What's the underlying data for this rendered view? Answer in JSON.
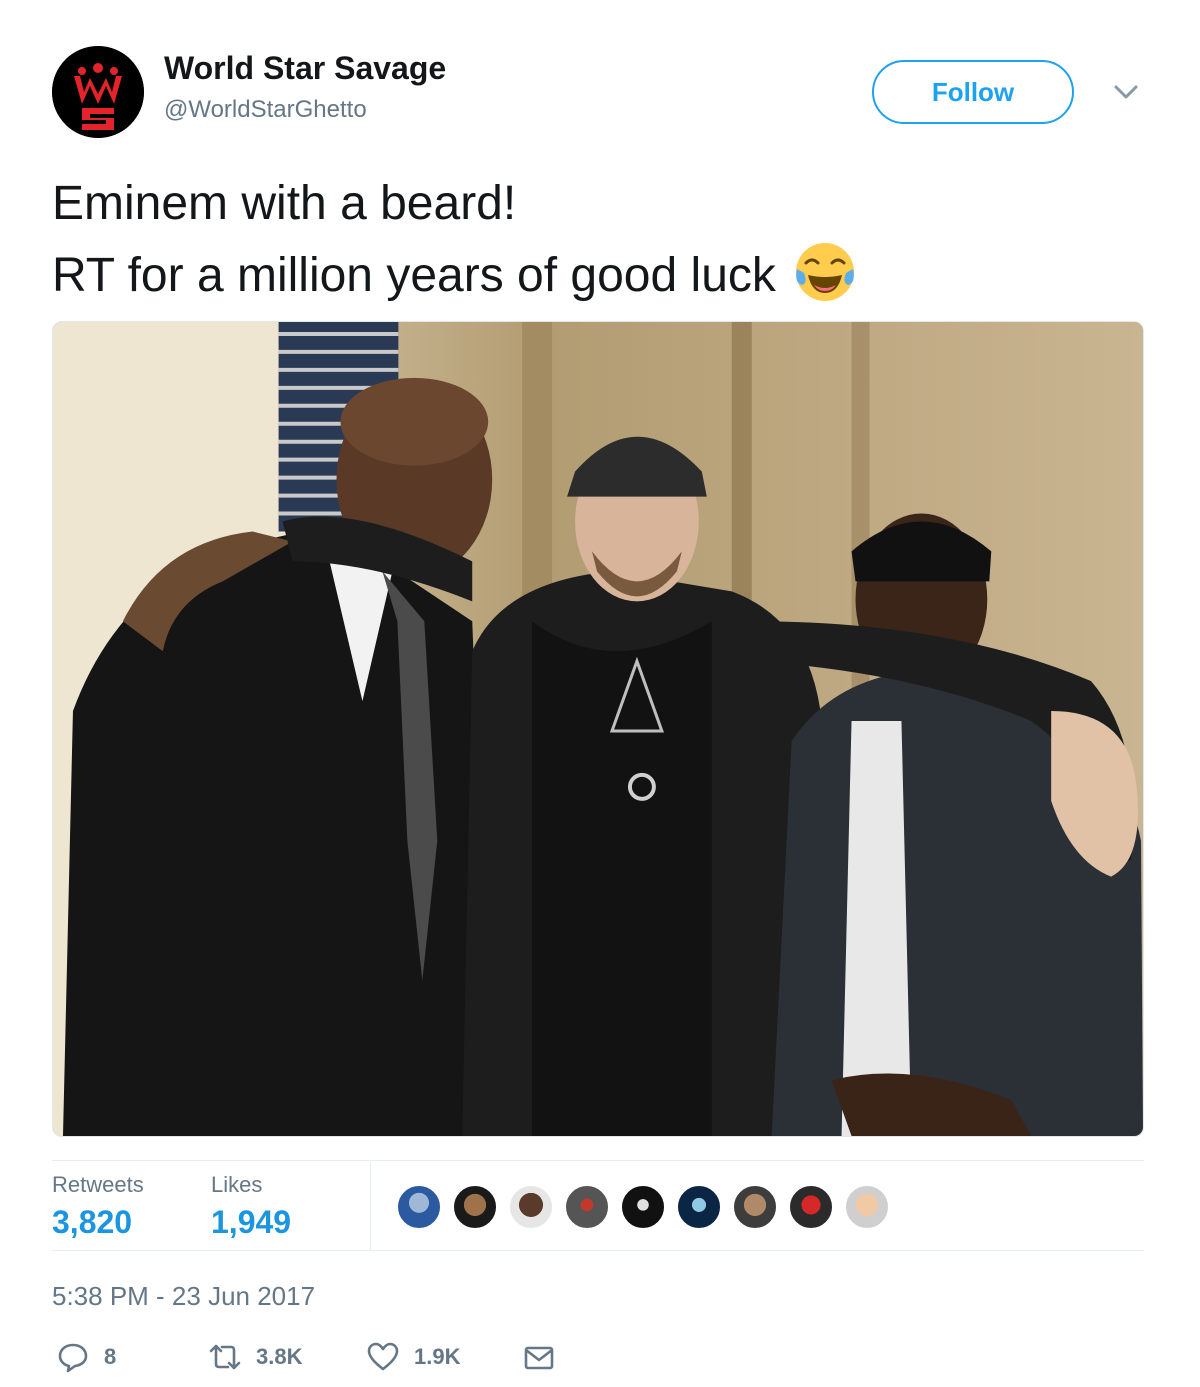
{
  "header": {
    "display_name": "World Star Savage",
    "handle": "@WorldStarGhetto",
    "follow_label": "Follow",
    "avatar_logo_text": "WS"
  },
  "tweet": {
    "line1": "Eminem with a beard!",
    "line2": "RT for a million years of good luck",
    "emoji": "face-with-tears-of-joy-emoji"
  },
  "stats": {
    "retweets_label": "Retweets",
    "retweets_value": "3,820",
    "likes_label": "Likes",
    "likes_value": "1,949"
  },
  "timestamp": "5:38 PM - 23 Jun 2017",
  "actions": {
    "reply_count": "8",
    "retweet_count": "3.8K",
    "like_count": "1.9K"
  },
  "colors": {
    "accent": "#1da1f2",
    "stat_value": "#1b95e0",
    "muted": "#657786",
    "logo_red": "#e4232a"
  }
}
